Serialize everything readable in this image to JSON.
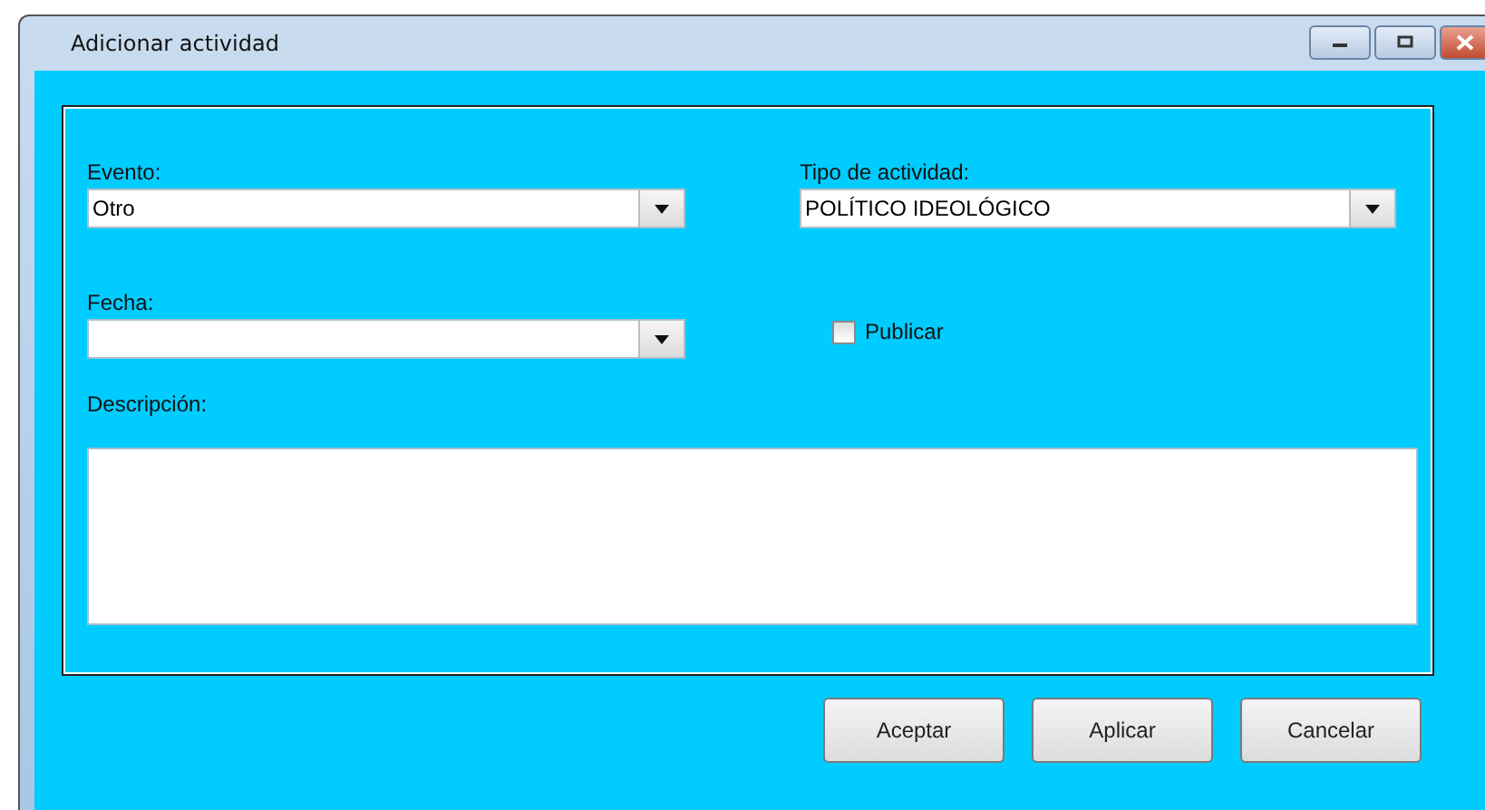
{
  "window": {
    "title": "Adicionar actividad"
  },
  "form": {
    "evento": {
      "label": "Evento:",
      "value": "Otro"
    },
    "tipo": {
      "label": "Tipo de actividad:",
      "value": "POLÍTICO IDEOLÓGICO"
    },
    "fecha": {
      "label": "Fecha:"
    },
    "publicar": {
      "label": "Publicar",
      "checked": false
    },
    "descripcion": {
      "label": "Descripción:"
    }
  },
  "buttons": [
    "Aceptar",
    "Aplicar",
    "Cancelar"
  ]
}
